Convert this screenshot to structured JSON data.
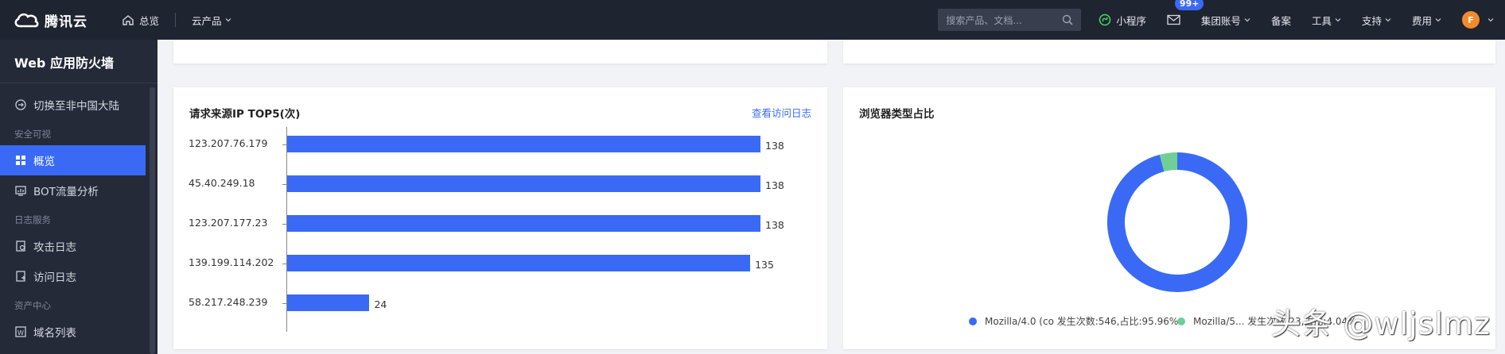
{
  "header": {
    "brand": "腾讯云",
    "overview": "总览",
    "products": "云产品",
    "search_placeholder": "搜索产品、文档...",
    "mini_program": "小程序",
    "badge": "99+",
    "account": "集团账号",
    "filing": "备案",
    "tools": "工具",
    "support": "支持",
    "billing": "费用",
    "avatar": "F"
  },
  "sidebar": {
    "title": "Web 应用防火墙",
    "switch_region": "切换至非中国大陆",
    "groups": [
      {
        "label": "安全可视"
      },
      {
        "label": "日志服务"
      },
      {
        "label": "资产中心"
      }
    ],
    "items": [
      {
        "label": "概览"
      },
      {
        "label": "BOT流量分析"
      },
      {
        "label": "攻击日志"
      },
      {
        "label": "访问日志"
      },
      {
        "label": "域名列表"
      }
    ]
  },
  "ip_card": {
    "title": "请求来源IP TOP5(次)",
    "link": "查看访问日志"
  },
  "browser_card": {
    "title": "浏览器类型占比",
    "legend": [
      {
        "label": "Mozilla/4.0 (co 发生次数:546,占比:95.96%",
        "color": "#3a6af5"
      },
      {
        "label": "Mozilla/5... 发生次数:23,占比:4.04%",
        "color": "#6fcf97"
      }
    ]
  },
  "chart_data": [
    {
      "type": "bar",
      "orientation": "horizontal",
      "title": "请求来源IP TOP5(次)",
      "categories": [
        "123.207.76.179",
        "45.40.249.18",
        "123.207.177.23",
        "139.199.114.202",
        "58.217.248.239"
      ],
      "values": [
        138,
        138,
        138,
        135,
        24
      ],
      "xlim": [
        0,
        138
      ]
    },
    {
      "type": "pie",
      "title": "浏览器类型占比",
      "donut": true,
      "labels": [
        "Mozilla/4.0 (co",
        "Mozilla/5..."
      ],
      "values": [
        546,
        23
      ],
      "colors": [
        "#3a6af5",
        "#6fcf97"
      ]
    }
  ],
  "watermark": "头条 @wljslmz"
}
